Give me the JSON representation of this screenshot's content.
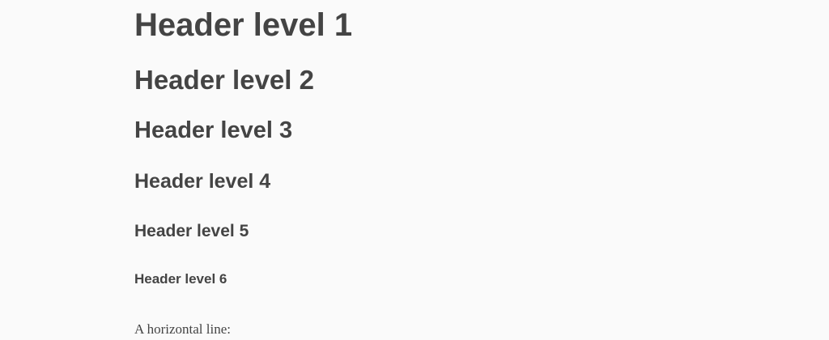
{
  "document": {
    "headers": [
      "Header level 1",
      "Header level 2",
      "Header level 3",
      "Header level 4",
      "Header level 5",
      "Header level 6"
    ],
    "paragraph": "A horizontal line:"
  },
  "colors": {
    "background": "#fafafa",
    "text": "#444444"
  }
}
